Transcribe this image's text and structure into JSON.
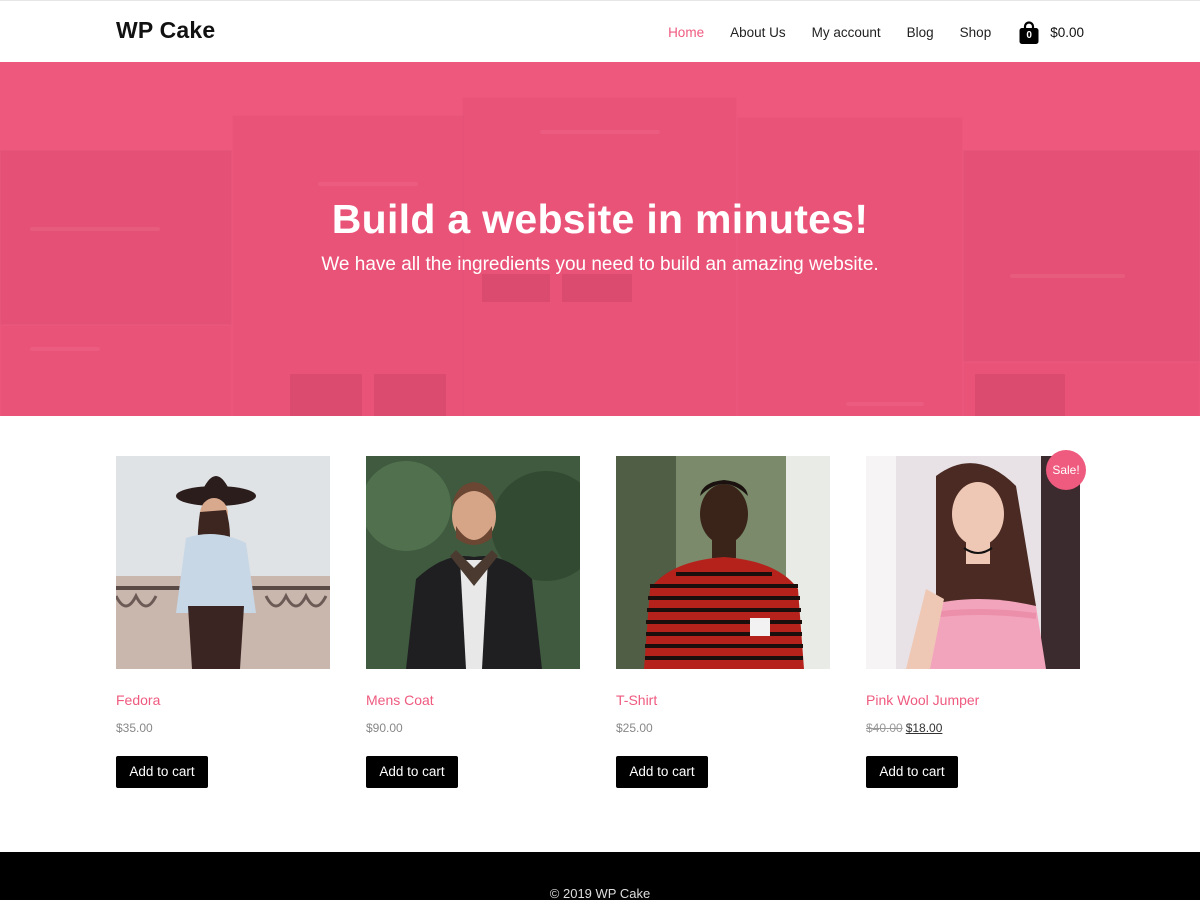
{
  "header": {
    "logo": "WP Cake",
    "nav": [
      {
        "label": "Home",
        "active": true
      },
      {
        "label": "About Us",
        "active": false
      },
      {
        "label": "My account",
        "active": false
      },
      {
        "label": "Blog",
        "active": false
      },
      {
        "label": "Shop",
        "active": false
      }
    ],
    "cart": {
      "count": "0",
      "total": "$0.00",
      "icon": "shopping-bag-icon"
    }
  },
  "hero": {
    "title": "Build a website in minutes!",
    "subtitle": "We have all the ingredients you need to build an amazing website."
  },
  "products": [
    {
      "name": "Fedora",
      "price": "$35.00",
      "button": "Add to cart"
    },
    {
      "name": "Mens Coat",
      "price": "$90.00",
      "button": "Add to cart"
    },
    {
      "name": "T-Shirt",
      "price": "$25.00",
      "button": "Add to cart"
    },
    {
      "name": "Pink Wool Jumper",
      "old_price": "$40.00",
      "price": "$18.00",
      "button": "Add to cart",
      "badge": "Sale!"
    }
  ],
  "footer": {
    "copyright": "© 2019 WP Cake"
  },
  "colors": {
    "accent": "#ef5a7f",
    "button": "#000000",
    "footer": "#000000"
  }
}
